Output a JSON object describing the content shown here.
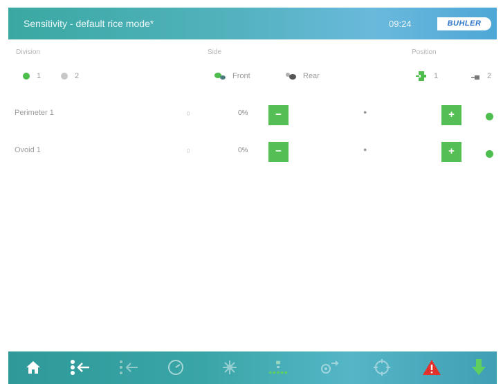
{
  "header": {
    "title": "Sensitivity - default rice mode*",
    "time": "09:24",
    "logo_text": "BUHLER"
  },
  "division": {
    "label": "Division",
    "options": [
      {
        "label": "1",
        "selected": true
      },
      {
        "label": "2",
        "selected": false
      }
    ]
  },
  "side": {
    "label": "Side",
    "options": [
      {
        "label": "Front",
        "selected": true
      },
      {
        "label": "Rear",
        "selected": false
      }
    ]
  },
  "position": {
    "label": "Position",
    "options": [
      {
        "label": "1",
        "selected": true
      },
      {
        "label": "2",
        "selected": false
      }
    ]
  },
  "rows": [
    {
      "label": "Perimeter 1",
      "small": "0",
      "value": "0%",
      "minus": "−",
      "plus": "+"
    },
    {
      "label": "Ovoid 1",
      "small": "0",
      "value": "0%",
      "minus": "−",
      "plus": "+"
    }
  ],
  "colors": {
    "accent_green": "#55bf55",
    "header_teal": "#3aa8a2",
    "header_blue": "#6ab9dc",
    "alert_red": "#e0322b"
  },
  "toolbar": {
    "items": [
      "home-icon",
      "sort-enter-icon",
      "sort-enter-dim-icon",
      "gauge-icon",
      "snowflake-icon",
      "ejector-row-icon",
      "settings-transfer-icon",
      "target-icon",
      "warning-icon",
      "download-icon"
    ]
  }
}
